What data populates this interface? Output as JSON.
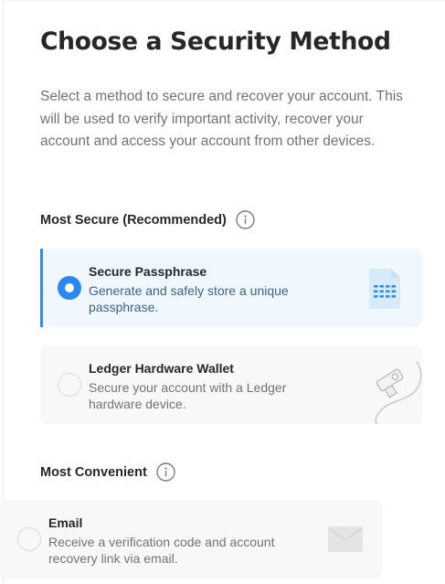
{
  "page": {
    "title": "Choose a Security Method",
    "description": "Select a method to secure and recover your account. This will be used to verify important activity, recover your account and access your account from other devices."
  },
  "sections": [
    {
      "heading": "Most Secure (Recommended)",
      "info_icon": "info-icon",
      "options": [
        {
          "title": "Secure Passphrase",
          "description": "Generate and safely store a unique passphrase.",
          "selected": true,
          "illustration": "passphrase-document-icon"
        },
        {
          "title": "Ledger Hardware Wallet",
          "description": "Secure your account with a Ledger hardware device.",
          "selected": false,
          "illustration": "ledger-device-icon"
        }
      ]
    },
    {
      "heading": "Most Convenient",
      "info_icon": "info-icon",
      "options": [
        {
          "title": "Email",
          "description": "Receive a verification code and account recovery link via email.",
          "selected": false,
          "illustration": "envelope-icon"
        }
      ]
    }
  ],
  "colors": {
    "accent": "#2f8cf7",
    "radio_selected": "#2b87f6",
    "selected_background": "#f0f7fe",
    "option_background": "#f8f8f8",
    "heading_text": "#25272a",
    "muted_text": "#72727a"
  }
}
